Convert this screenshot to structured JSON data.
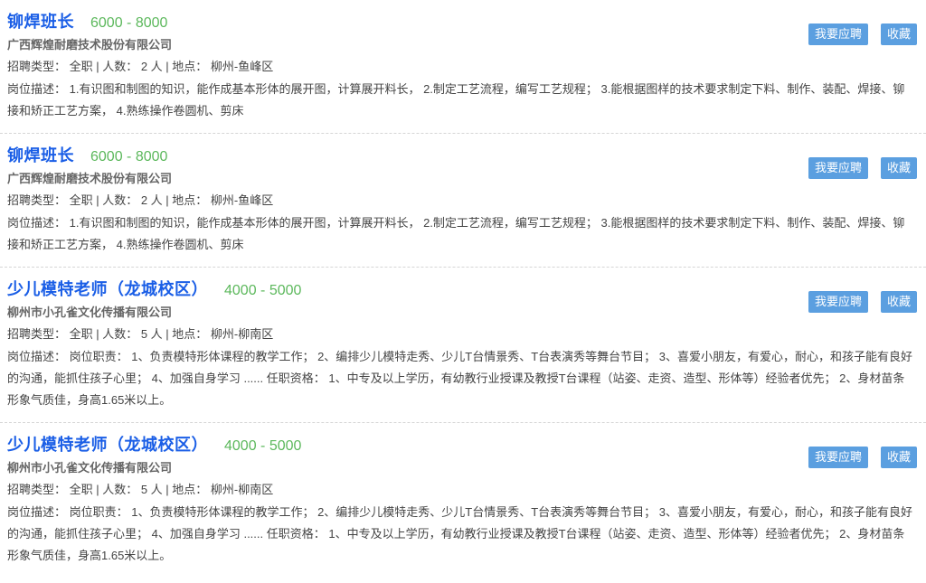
{
  "labels": {
    "apply": "我要应聘",
    "favorite": "收藏"
  },
  "jobs": [
    {
      "title": "铆焊班长",
      "salary": "6000 - 8000",
      "company": "广西辉煌耐磨技术股份有限公司",
      "meta": "招聘类型： 全职 | 人数： 2 人 | 地点： 柳州-鱼峰区",
      "desc": "岗位描述： 1.有识图和制图的知识，能作成基本形体的展开图，计算展开料长， 2.制定工艺流程，编写工艺规程； 3.能根据图样的技术要求制定下料、制作、装配、焊接、铆接和矫正工艺方案， 4.熟练操作卷圆机、剪床"
    },
    {
      "title": "铆焊班长",
      "salary": "6000 - 8000",
      "company": "广西辉煌耐磨技术股份有限公司",
      "meta": "招聘类型： 全职 | 人数： 2 人 | 地点： 柳州-鱼峰区",
      "desc": "岗位描述： 1.有识图和制图的知识，能作成基本形体的展开图，计算展开料长， 2.制定工艺流程，编写工艺规程； 3.能根据图样的技术要求制定下料、制作、装配、焊接、铆接和矫正工艺方案， 4.熟练操作卷圆机、剪床"
    },
    {
      "title": "少儿模特老师（龙城校区）",
      "salary": "4000 - 5000",
      "company": "柳州市小孔雀文化传播有限公司",
      "meta": "招聘类型： 全职 | 人数： 5 人 | 地点： 柳州-柳南区",
      "desc": "岗位描述： 岗位职责： 1、负责模特形体课程的教学工作； 2、编排少儿模特走秀、少儿T台情景秀、T台表演秀等舞台节目； 3、喜爱小朋友，有爱心，耐心，和孩子能有良好的沟通，能抓住孩子心里； 4、加强自身学习 ...... 任职资格： 1、中专及以上学历，有幼教行业授课及教授T台课程（站姿、走资、造型、形体等）经验者优先； 2、身材苗条形象气质佳，身高1.65米以上。"
    },
    {
      "title": "少儿模特老师（龙城校区）",
      "salary": "4000 - 5000",
      "company": "柳州市小孔雀文化传播有限公司",
      "meta": "招聘类型： 全职 | 人数： 5 人 | 地点： 柳州-柳南区",
      "desc": "岗位描述： 岗位职责： 1、负责模特形体课程的教学工作； 2、编排少儿模特走秀、少儿T台情景秀、T台表演秀等舞台节目； 3、喜爱小朋友，有爱心，耐心，和孩子能有良好的沟通，能抓住孩子心里； 4、加强自身学习 ...... 任职资格： 1、中专及以上学历，有幼教行业授课及教授T台课程（站姿、走资、造型、形体等）经验者优先； 2、身材苗条形象气质佳，身高1.65米以上。"
    }
  ]
}
